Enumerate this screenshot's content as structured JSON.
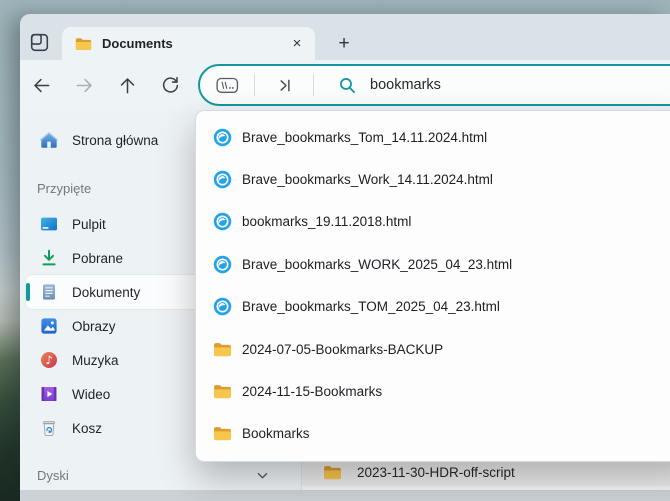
{
  "colors": {
    "accent": "#12989e",
    "titlebar_bg": "#d8e2e7",
    "toolbar_bg": "#eef3f6",
    "sidebar_bg": "#edf2f5",
    "dropdown_bg": "#fdfdfe",
    "html_file_icon_blue": "#25a3e9",
    "folder_yellow": "#f7c64d"
  },
  "titlebar": {
    "tab_label": "Documents"
  },
  "icons": {
    "close": "×",
    "new_tab": "+"
  },
  "toolbar": {
    "search_value": "bookmarks"
  },
  "sidebar": {
    "home_label": "Strona główna",
    "pinned_section_label": "Przypięte",
    "items": [
      {
        "label": "Pulpit",
        "selected": false
      },
      {
        "label": "Pobrane",
        "selected": false
      },
      {
        "label": "Dokumenty",
        "selected": true
      },
      {
        "label": "Obrazy",
        "selected": false
      },
      {
        "label": "Muzyka",
        "selected": false
      },
      {
        "label": "Wideo",
        "selected": false
      },
      {
        "label": "Kosz",
        "selected": false
      }
    ],
    "drives_section_label": "Dyski"
  },
  "search_dropdown": {
    "items": [
      {
        "name": "Brave_bookmarks_Tom_14.11.2024.html",
        "type": "html-file"
      },
      {
        "name": "Brave_bookmarks_Work_14.11.2024.html",
        "type": "html-file"
      },
      {
        "name": "bookmarks_19.11.2018.html",
        "type": "html-file"
      },
      {
        "name": "Brave_bookmarks_WORK_2025_04_23.html",
        "type": "html-file"
      },
      {
        "name": "Brave_bookmarks_TOM_2025_04_23.html",
        "type": "html-file"
      },
      {
        "name": "2024-07-05-Bookmarks-BACKUP",
        "type": "folder"
      },
      {
        "name": "2024-11-15-Bookmarks",
        "type": "folder"
      },
      {
        "name": "Bookmarks",
        "type": "folder"
      }
    ]
  },
  "file_list": {
    "partially_visible_row": {
      "name": "2023-11-30-HDR-off-script",
      "type": "folder"
    }
  }
}
